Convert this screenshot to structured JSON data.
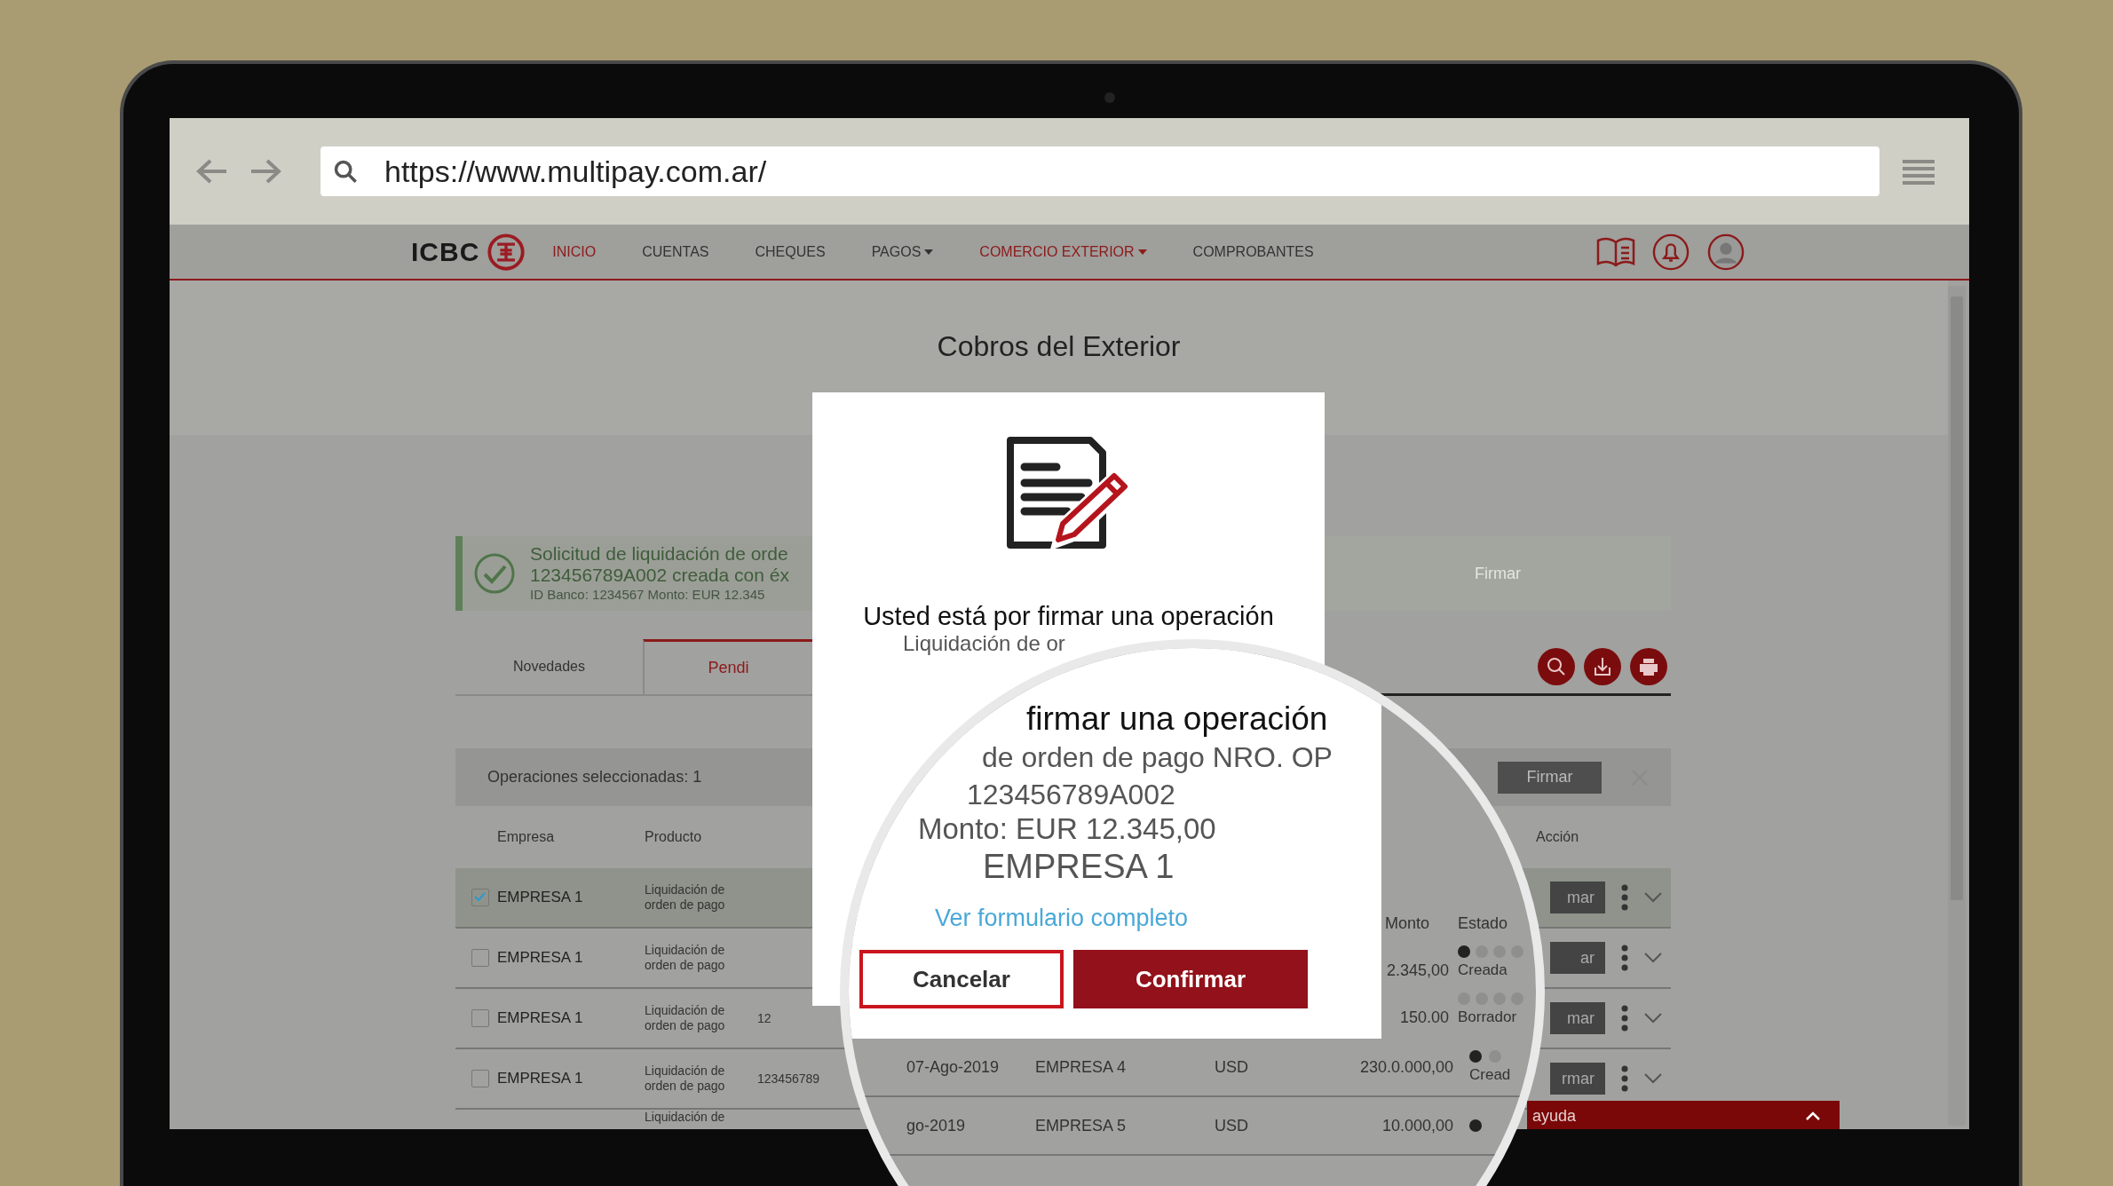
{
  "browser": {
    "url": "https://www.multipay.com.ar/"
  },
  "nav": {
    "logo": "ICBC",
    "items": [
      {
        "label": "INICIO",
        "selected": true,
        "dropdown": false
      },
      {
        "label": "CUENTAS",
        "selected": false,
        "dropdown": false
      },
      {
        "label": "CHEQUES",
        "selected": false,
        "dropdown": false
      },
      {
        "label": "PAGOS",
        "selected": false,
        "dropdown": true
      },
      {
        "label": "COMERCIO EXTERIOR",
        "selected": true,
        "dropdown": true
      },
      {
        "label": "COMPROBANTES",
        "selected": false,
        "dropdown": false
      }
    ]
  },
  "page": {
    "title": "Cobros del Exterior"
  },
  "alert": {
    "title": "Solicitud de liquidación de orde",
    "line": "123456789A002  creada con éx",
    "detail": "ID Banco: 1234567 Monto: EUR 12.345",
    "action": "Firmar"
  },
  "tabs": [
    {
      "label": "Novedades",
      "selected": false
    },
    {
      "label": "Pendi",
      "selected": true
    }
  ],
  "selection_bar": {
    "text": "Operaciones seleccionadas: 1",
    "button": "Firmar"
  },
  "table": {
    "columns": [
      "Empresa",
      "Producto"
    ],
    "action_column": "Acción",
    "rows": [
      {
        "selected": true,
        "checked": true,
        "empresa": "EMPRESA 1",
        "producto": "Liquidación de orden de pago",
        "column_3": "",
        "action": "mar"
      },
      {
        "selected": false,
        "checked": false,
        "empresa": "EMPRESA 1",
        "producto": "Liquidación de orden de pago",
        "column_3": "",
        "action": "ar"
      },
      {
        "selected": false,
        "checked": false,
        "empresa": "EMPRESA 1",
        "producto": "Liquidación de orden de pago",
        "column_3": "12",
        "action": "mar"
      },
      {
        "selected": false,
        "checked": false,
        "empresa": "EMPRESA 1",
        "producto": "Liquidación de orden de pago",
        "column_3": "123456789",
        "action": "rmar"
      },
      {
        "producto": "Liquidación de"
      }
    ]
  },
  "modal": {
    "title": "Usted está por firmar una operación",
    "subtitle": "Liquidación de or"
  },
  "magnifier": {
    "title": "firmar una operación",
    "line": "de orden de pago NRO. OP",
    "number": "123456789A002",
    "amount": "Monto: EUR 12.345,00",
    "company": "EMPRESA 1",
    "link": "Ver formulario completo",
    "cancel": "Cancelar",
    "confirm": "Confirmar",
    "side_columns": [
      "Monto",
      "Estado"
    ],
    "side_rows": [
      {
        "monto": "2.345,00",
        "estado": "Creada",
        "dots": [
          true,
          false,
          false,
          false
        ]
      },
      {
        "monto": "150.00",
        "estado": "Borrador",
        "dots": [
          false,
          false,
          false,
          false
        ]
      }
    ],
    "rows": [
      {
        "fecha": "07-Ago-2019",
        "empresa": "EMPRESA 4",
        "moneda": "USD",
        "monto": "230.0.000,00",
        "estado": "Cread",
        "dots": [
          true,
          false
        ]
      },
      {
        "fecha": "go-2019",
        "empresa": "EMPRESA 5",
        "moneda": "USD",
        "monto": "10.000,00",
        "estado": "",
        "dots": [
          true
        ]
      }
    ]
  },
  "help_bar": {
    "label": "ayuda"
  }
}
